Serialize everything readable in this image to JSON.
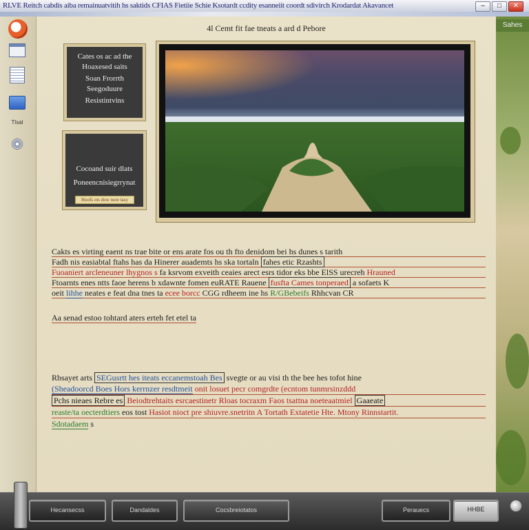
{
  "window": {
    "title": "RLVE Reitch cabdis aiba remainuatvitih hs saktids CFIAS Fietiie Schie Ksotardt ccdity esanneiit coordt sdivirch Krodardat Akavancet",
    "min_label": "–",
    "max_label": "□",
    "close_label": "✕"
  },
  "left_toolbar": {
    "icons": [
      "app-logo-icon",
      "document-icon",
      "list-icon",
      "folder-icon",
      "cd-icon"
    ],
    "small_label": "Tlsal"
  },
  "main": {
    "heading": "4l Cemt fit fae tneats a ard d Pebore",
    "card1_lines": [
      "Cates os ac ad the",
      "Hoaxesed saits",
      "Soan Frorrth",
      "Seegoduure",
      "Resistintvins"
    ],
    "card2_lines": [
      "Cocoand suir dlats",
      "Poneencnisiegrrynat"
    ],
    "card2_pill": "Hoofs ots dow nore tasy",
    "paragraph1": {
      "line1": "Cakts es virting eaent ns trae bite or ens arate fos ou th fto denidom bei hs dunes s tarith",
      "line2_a": "Fadh   nis easiabtal ftahs has",
      "line2_b": "da  Hinerer auademts hs ska tortaln",
      "line2_c": "fahes etic Rzashts",
      "line3_red": "Fuoaniert arcleneuner lhygnos s",
      "line3_mid": "fa ksrvom exveith  ceaies arect esrs tidor eks bbe ElSS urecreh",
      "line3_end": "Hrauned",
      "line4_a": "Ftoarnts enes ntts faoe herens b    xdawnte fomen euRATE Rauene",
      "line4_red": "fusfta Cames tonperaed",
      "line4_b": "a sofaets K",
      "line5_a": "oeit",
      "line5_blue": "lihhe",
      "line5_b": "neates e feat dna tnes ta",
      "line5_red": "ecee borcc",
      "line5_c": "CGG  rdheem ine hs",
      "line5_green": "R/GBebeifs",
      "line5_d": "Rhhcvan CR"
    },
    "paragraph2": "Aa senad estoo tohtard aters erteh fet etel ta",
    "paragraph3": {
      "line1_a": "Rbsayet arts",
      "line1_blue": "SEGusrtt hes iteats eccanemstoah Bes",
      "line1_b": "svegte or au visi th the bee hes tofot hine",
      "line2_blue": "(Sheadoorcd  Boes  Hors  kerrnzer  resdtmeit",
      "line2_red": "onit  losuet   pecr  comgrdte  (ecntom tunmrsinzddd",
      "line3_a": "Pchs nieaes Rebre  es",
      "line3_red": "Beiodtrehtaits   esrcaestinetr   Rloas  tocraxm  Faos  tsattna  noeteaatmiel",
      "line3_b": "Gaaeate",
      "line4_green": "reaste/ta oecterdtiers",
      "line4_a": "eos tost",
      "line4_red": "Hasiot nioct pre shiuvre.snetritn A Tortath Extatetie Hte. Mtony  Rinnstartit.",
      "line5_green": "Sdotadaem",
      "line5_a": "s"
    }
  },
  "right_strip": {
    "label": "Sahes"
  },
  "bottom_bar": {
    "btn1": "Hecansecss",
    "btn2": "Dandaldes",
    "btn3": "Cocsbreiotatos",
    "btn4": "Perauecs",
    "btn5": "HHBE"
  }
}
